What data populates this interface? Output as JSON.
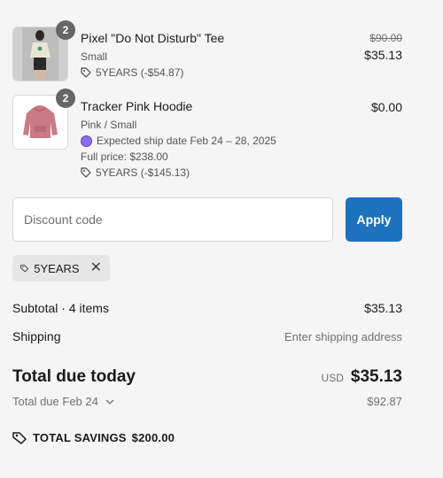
{
  "items": [
    {
      "name": "Pixel \"Do Not Disturb\" Tee",
      "variant": "Small",
      "quantity": "2",
      "discount": "5YEARS (-$54.87)",
      "original_price": "$90.00",
      "price": "$35.13"
    },
    {
      "name": "Tracker Pink Hoodie",
      "variant": "Pink / Small",
      "quantity": "2",
      "ship_note": "Expected ship date Feb 24 – 28, 2025",
      "full_price": "Full price: $238.00",
      "discount": "5YEARS (-$145.13)",
      "price": "$0.00"
    }
  ],
  "discount": {
    "placeholder": "Discount code",
    "apply_label": "Apply",
    "applied_code": "5YEARS"
  },
  "summary": {
    "subtotal_label": "Subtotal · 4 items",
    "subtotal_value": "$35.13",
    "shipping_label": "Shipping",
    "shipping_value": "Enter shipping address",
    "total_label": "Total due today",
    "currency": "USD",
    "total_value": "$35.13",
    "due_label": "Total due Feb 24",
    "due_value": "$92.87",
    "savings_label": "TOTAL SAVINGS",
    "savings_value": "$200.00"
  },
  "colors": {
    "accent": "#1e72bd",
    "background": "#f5f5f5",
    "ship_dot": "#8e6cf0"
  }
}
